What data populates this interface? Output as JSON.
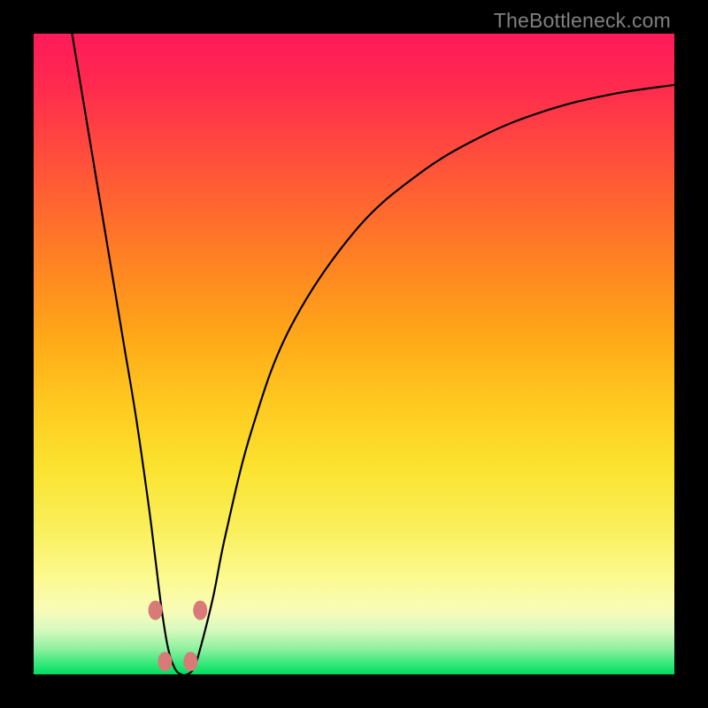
{
  "watermark": "TheBottleneck.com",
  "chart_data": {
    "type": "line",
    "title": "",
    "xlabel": "",
    "ylabel": "",
    "xlim": [
      0,
      100
    ],
    "ylim": [
      0,
      100
    ],
    "series": [
      {
        "name": "curve",
        "x": [
          6,
          8,
          10,
          12,
          14,
          16,
          18,
          19,
          20,
          21,
          22,
          23,
          24,
          25,
          26,
          28,
          30,
          34,
          40,
          50,
          60,
          70,
          80,
          90,
          100
        ],
        "y": [
          100,
          88,
          76,
          64,
          52,
          40,
          26,
          18,
          10,
          4,
          1,
          0,
          0,
          1,
          4,
          12,
          22,
          38,
          54,
          69,
          78,
          84,
          88,
          90.5,
          92
        ]
      }
    ],
    "markers": [
      {
        "x": 19.0,
        "y": 10
      },
      {
        "x": 20.5,
        "y": 2
      },
      {
        "x": 24.5,
        "y": 2
      },
      {
        "x": 26.0,
        "y": 10
      }
    ],
    "gradient_stops": [
      {
        "pos": 0,
        "color": "#ff1a5a"
      },
      {
        "pos": 50,
        "color": "#ffca20"
      },
      {
        "pos": 85,
        "color": "#fcfa90"
      },
      {
        "pos": 100,
        "color": "#00dc60"
      }
    ]
  }
}
